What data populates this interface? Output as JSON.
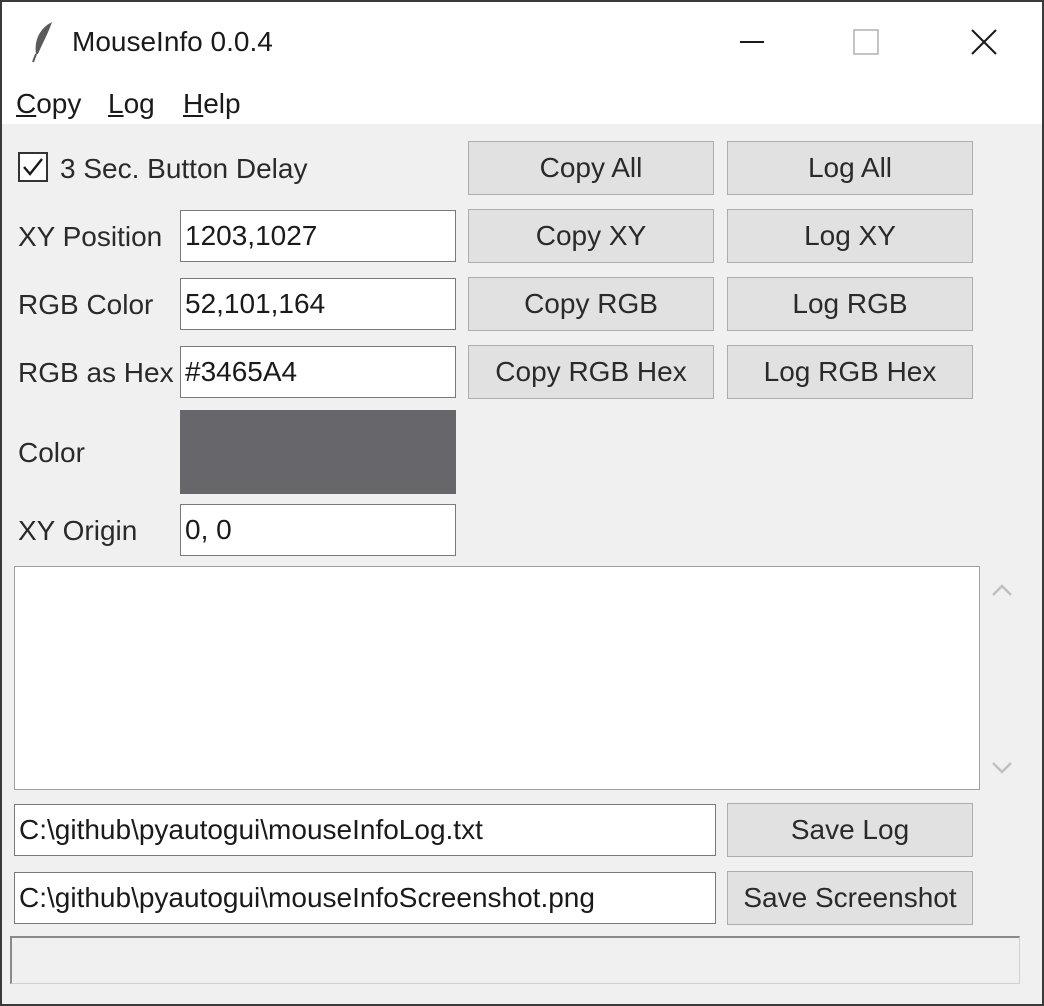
{
  "window": {
    "title": "MouseInfo 0.0.4"
  },
  "menu": {
    "items": [
      {
        "label": "Copy"
      },
      {
        "label": "Log"
      },
      {
        "label": "Help"
      }
    ]
  },
  "delay": {
    "label": "3 Sec. Button Delay",
    "checked": true
  },
  "rows": {
    "xy": {
      "label": "XY Position",
      "value": "1203,1027",
      "copy": "Copy XY",
      "log": "Log XY"
    },
    "rgb": {
      "label": "RGB Color",
      "value": "52,101,164",
      "copy": "Copy RGB",
      "log": "Log RGB"
    },
    "hex": {
      "label": "RGB as Hex",
      "value": "#3465A4",
      "copy": "Copy RGB Hex",
      "log": "Log RGB Hex"
    },
    "color": {
      "label": "Color",
      "swatch": "#67676b"
    },
    "origin": {
      "label": "XY Origin",
      "value": "0, 0"
    }
  },
  "all_buttons": {
    "copy": "Copy All",
    "log": "Log All"
  },
  "log": {
    "text": ""
  },
  "files": {
    "log_path": "C:\\github\\pyautogui\\mouseInfoLog.txt",
    "save_log": "Save Log",
    "screenshot_path": "C:\\github\\pyautogui\\mouseInfoScreenshot.png",
    "save_screenshot": "Save Screenshot"
  },
  "status": {
    "text": ""
  },
  "icons": {
    "app": "feather-icon",
    "minimize": "minimize-icon",
    "maximize": "maximize-icon",
    "close": "close-icon",
    "checkbox": "checkmark-icon",
    "scroll_up": "chevron-up-icon",
    "scroll_down": "chevron-down-icon"
  }
}
